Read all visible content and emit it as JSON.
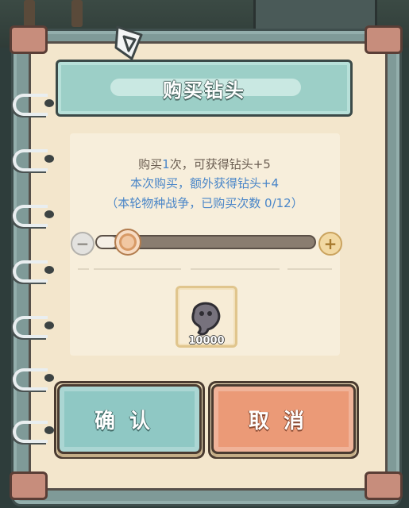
{
  "dialog": {
    "title": "购买钻头"
  },
  "info": {
    "line1_prefix": "购买",
    "line1_count": "1",
    "line1_suffix": "次，可获得钻头+5",
    "line2": "本次购买，额外获得钻头+4",
    "line3": "（本轮物种战争，已购买次数 0/12）"
  },
  "slider": {
    "minus_label": "−",
    "plus_label": "+",
    "value_fraction": 0.09
  },
  "item": {
    "icon": "drill-blob-icon",
    "quantity": "10000"
  },
  "buttons": {
    "confirm": "确认",
    "cancel": "取消"
  },
  "colors": {
    "accent_blue": "#4a86c8",
    "confirm_bg": "#8fc8c4",
    "cancel_bg": "#eb9a77",
    "title_bg": "#9ccfc7"
  }
}
